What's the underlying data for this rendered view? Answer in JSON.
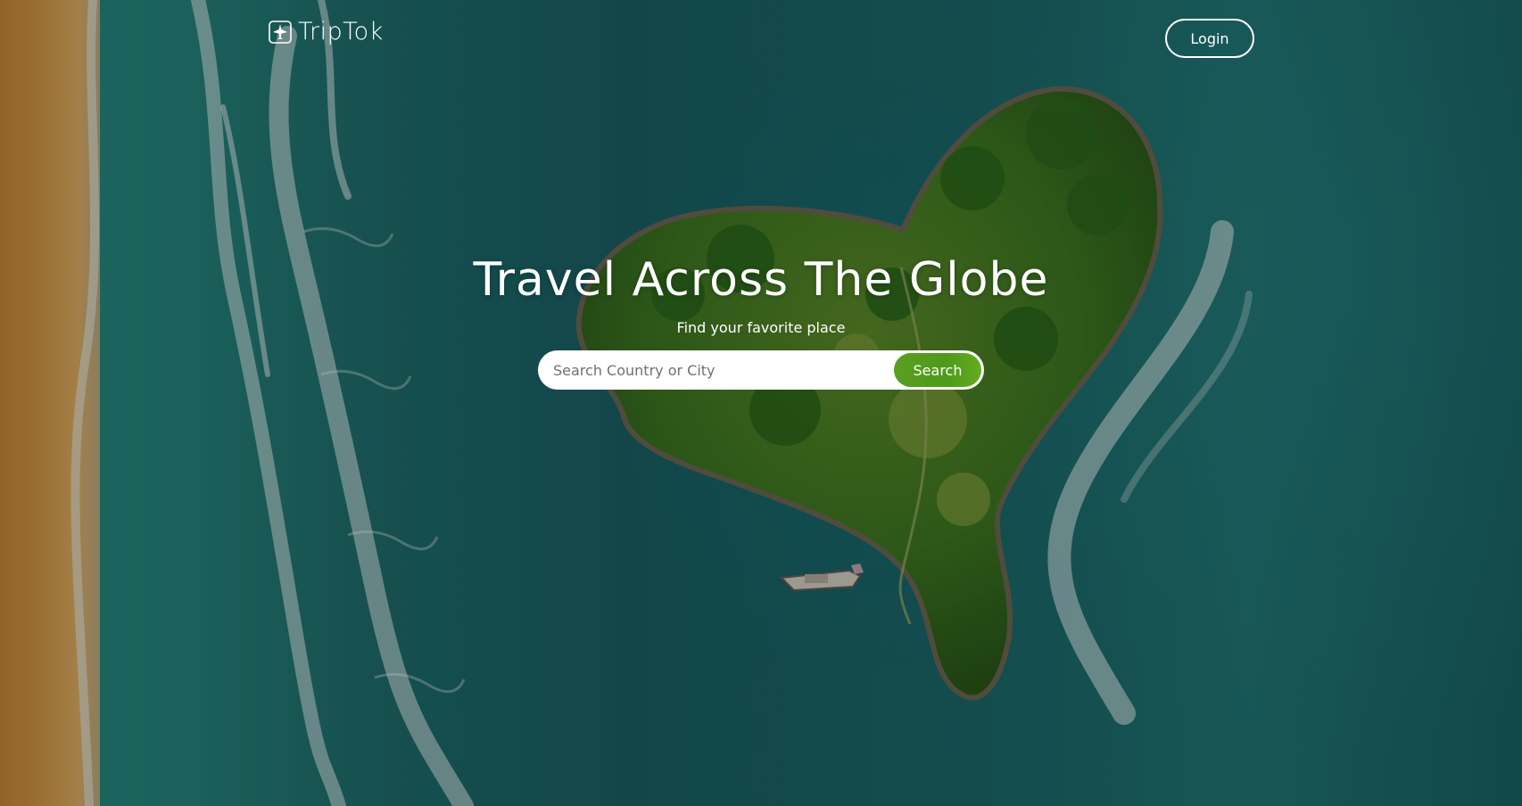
{
  "header": {
    "brand_name": "TripTok",
    "brand_icon": "airplane-icon",
    "login_label": "Login"
  },
  "hero": {
    "title": "Travel Across The Globe",
    "subtitle": "Find your favorite place"
  },
  "search": {
    "placeholder": "Search Country or City",
    "value": "",
    "button_label": "Search"
  },
  "colors": {
    "accent": "#5a9e22",
    "text": "#ffffff",
    "ocean": "#1b6266",
    "sand": "#d79c4a"
  }
}
